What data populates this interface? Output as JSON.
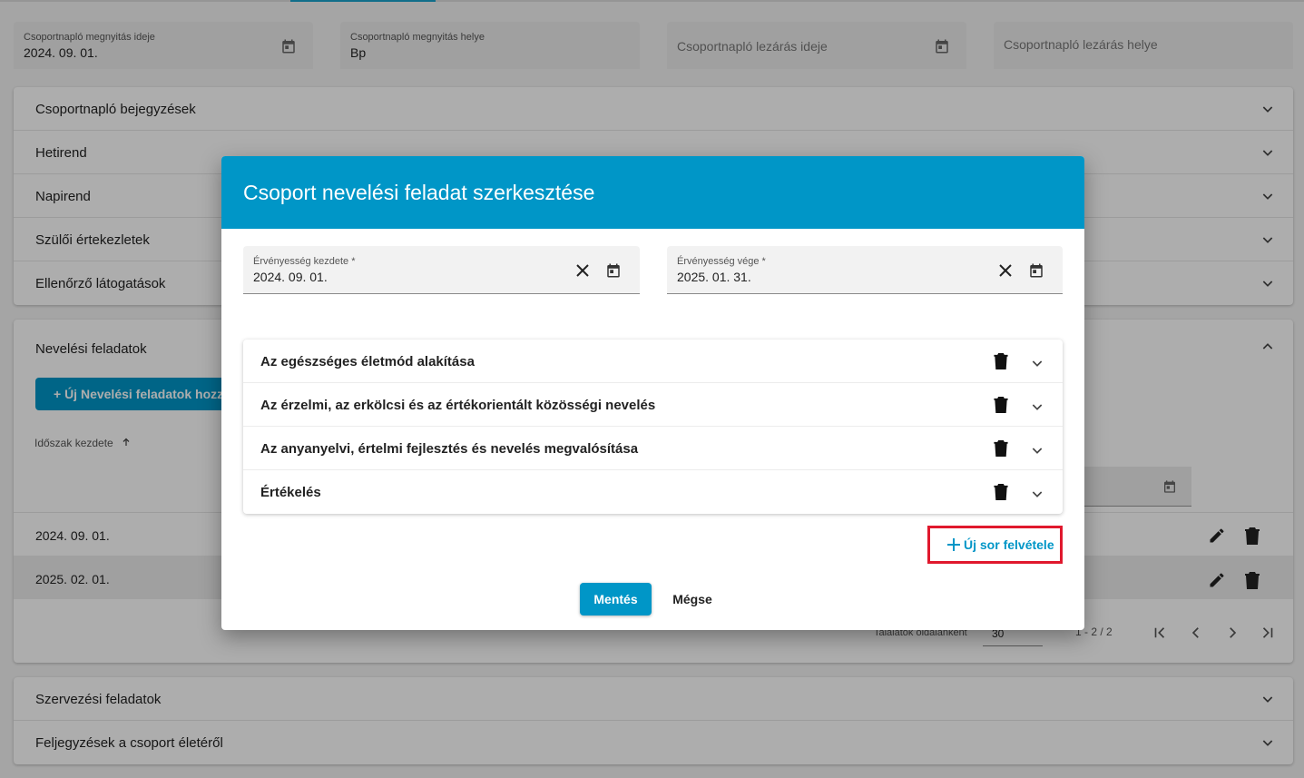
{
  "background": {
    "fields": [
      {
        "label": "Csoportnapló megnyitás ideje",
        "value": "2024. 09. 01.",
        "icon": "calendar-icon"
      },
      {
        "label": "Csoportnapló megnyitás helye",
        "value": "Bp"
      },
      {
        "placeholder": "Csoportnapló lezárás ideje",
        "icon": "calendar-icon"
      },
      {
        "placeholder": "Csoportnapló lezárás helye"
      }
    ],
    "sections": [
      "Csoportnapló bejegyzések",
      "Hetirend",
      "Napirend",
      "Szülői értekezletek",
      "Ellenőrző látogatások"
    ],
    "nevelesi": {
      "title": "Nevelési feladatok",
      "add_button": "+ Új Nevelési feladatok hozz",
      "sort_label": "Időszak kezdete",
      "rows": [
        "2024. 09. 01.",
        "2025. 02. 01."
      ],
      "per_page_label": "Találatok oldalanként",
      "per_page_value": "30",
      "range": "1 - 2 / 2"
    },
    "bottom_sections": [
      "Szervezési feladatok",
      "Feljegyzések a csoport életéről"
    ]
  },
  "dialog": {
    "title": "Csoport nevelési feladat szerkesztése",
    "start": {
      "label": "Érvényesség kezdete *",
      "value": "2024. 09. 01."
    },
    "end": {
      "label": "Érvényesség vége *",
      "value": "2025. 01. 31."
    },
    "items": [
      "Az egészséges életmód alakítása",
      "Az érzelmi, az erkölcsi és az értékorientált közösségi nevelés",
      "Az anyanyelvi, értelmi fejlesztés és nevelés megvalósítása",
      "Értékelés"
    ],
    "add_row": "Új sor felvétele",
    "save": "Mentés",
    "cancel": "Mégse"
  },
  "colors": {
    "accent": "#0096c7",
    "highlight": "#e0182d"
  }
}
